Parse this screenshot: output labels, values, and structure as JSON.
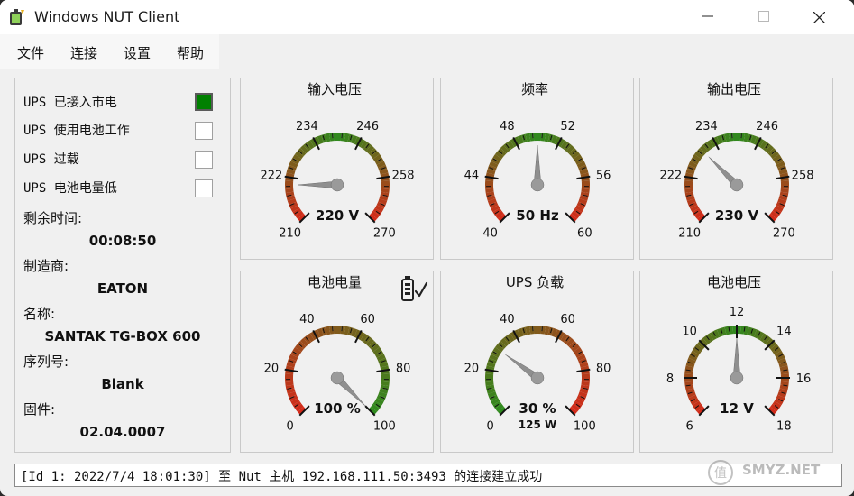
{
  "window": {
    "title": "Windows NUT Client"
  },
  "menu": [
    "文件",
    "连接",
    "设置",
    "帮助"
  ],
  "status": [
    {
      "label": "UPS 已接入市电",
      "checked": true
    },
    {
      "label": "UPS 使用电池工作",
      "checked": false
    },
    {
      "label": "UPS 过载",
      "checked": false
    },
    {
      "label": "UPS 电池电量低",
      "checked": false
    }
  ],
  "info": [
    {
      "label": "剩余时间:",
      "value": "00:08:50"
    },
    {
      "label": "制造商:",
      "value": "EATON"
    },
    {
      "label": "名称:",
      "value": "SANTAK TG-BOX 600"
    },
    {
      "label": "序列号:",
      "value": "Blank"
    },
    {
      "label": "固件:",
      "value": "02.04.0007"
    }
  ],
  "gauges": [
    {
      "title": "输入电压",
      "min": 210,
      "max": 270,
      "ticks": [
        "210",
        "222",
        "234",
        "246",
        "258",
        "270"
      ],
      "value": 220,
      "display": "220 V",
      "sub": "",
      "scheme": "center",
      "icon": ""
    },
    {
      "title": "频率",
      "min": 40,
      "max": 60,
      "ticks": [
        "40",
        "44",
        "48",
        "52",
        "56",
        "60"
      ],
      "value": 50,
      "display": "50 Hz",
      "sub": "",
      "scheme": "center",
      "icon": ""
    },
    {
      "title": "输出电压",
      "min": 210,
      "max": 270,
      "ticks": [
        "210",
        "222",
        "234",
        "246",
        "258",
        "270"
      ],
      "value": 230,
      "display": "230 V",
      "sub": "",
      "scheme": "center",
      "icon": ""
    },
    {
      "title": "电池电量",
      "min": 0,
      "max": 100,
      "ticks": [
        "0",
        "20",
        "40",
        "60",
        "80",
        "100"
      ],
      "value": 100,
      "display": "100 %",
      "sub": "",
      "scheme": "high-good",
      "icon": "battery-check"
    },
    {
      "title": "UPS 负载",
      "min": 0,
      "max": 100,
      "ticks": [
        "0",
        "20",
        "40",
        "60",
        "80",
        "100"
      ],
      "value": 30,
      "display": "30 %",
      "sub": "125 W",
      "scheme": "low-good",
      "icon": ""
    },
    {
      "title": "电池电压",
      "min": 6,
      "max": 18,
      "ticks": [
        "6",
        "8",
        "10",
        "12",
        "14",
        "16",
        "18"
      ],
      "value": 12,
      "display": "12 V",
      "sub": "",
      "scheme": "center",
      "icon": ""
    }
  ],
  "log": "[Id 1: 2022/7/4 18:01:30] 至 Nut 主机 192.168.111.50:3493 的连接建立成功",
  "watermark": "SMYZ.NET",
  "colors": {
    "red": "#d42a1a",
    "green": "#2e8b1e",
    "checked_box": "#008000"
  }
}
